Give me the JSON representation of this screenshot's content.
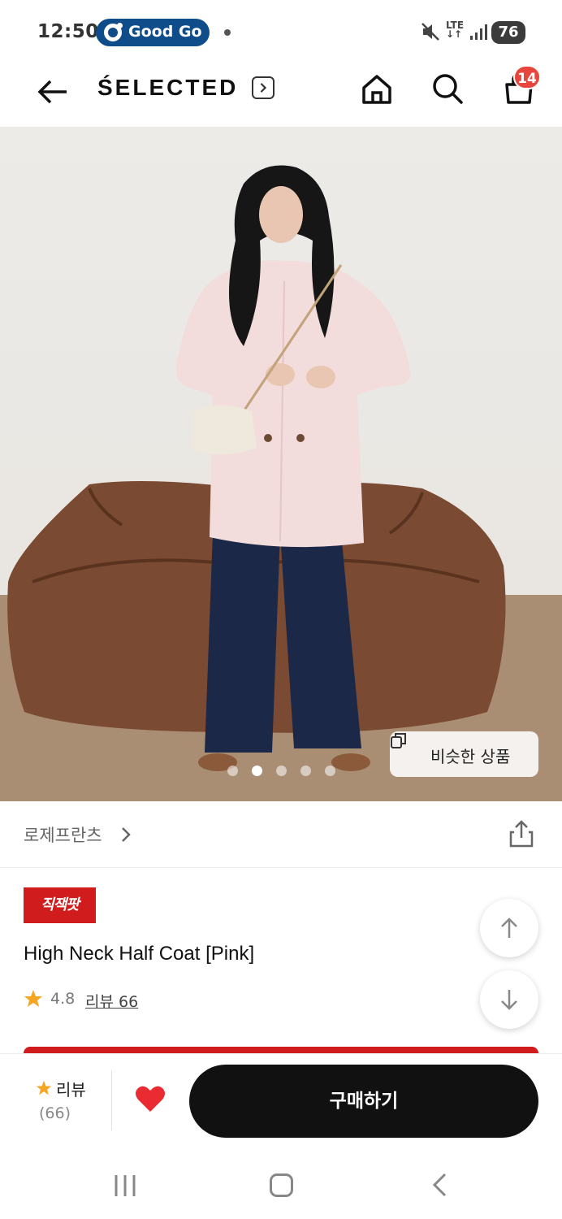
{
  "status_bar": {
    "time": "12:50",
    "notification_pill": "Good Go",
    "network": "LTE",
    "battery": "76"
  },
  "header": {
    "brand": "ŚELECTED",
    "cart_count": "14"
  },
  "gallery": {
    "similar_products_label": "비슷한 상품",
    "page_count": 5,
    "active_page": 2
  },
  "brand_row": {
    "brand_name": "로제프란츠"
  },
  "product": {
    "badge": "직잭팟",
    "title": "High Neck Half Coat [Pink]",
    "rating": "4.8",
    "reviews_label": "리뷰 66"
  },
  "bottom_bar": {
    "review_label": "리뷰",
    "review_count": "(66)",
    "buy_label": "구매하기"
  },
  "colors": {
    "accent_red": "#d01c1c",
    "badge_red": "#e8453c",
    "star_orange": "#f5a623",
    "buy_button": "#111111"
  }
}
